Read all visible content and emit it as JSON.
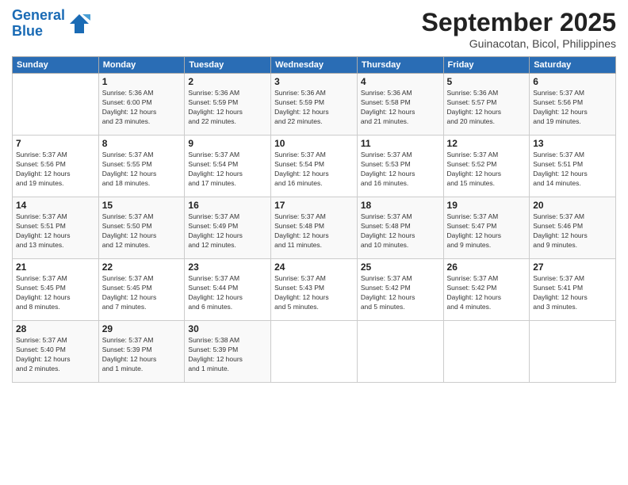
{
  "logo": {
    "line1": "General",
    "line2": "Blue"
  },
  "header": {
    "month": "September 2025",
    "location": "Guinacotan, Bicol, Philippines"
  },
  "columns": [
    "Sunday",
    "Monday",
    "Tuesday",
    "Wednesday",
    "Thursday",
    "Friday",
    "Saturday"
  ],
  "weeks": [
    [
      {
        "day": "",
        "info": ""
      },
      {
        "day": "1",
        "info": "Sunrise: 5:36 AM\nSunset: 6:00 PM\nDaylight: 12 hours\nand 23 minutes."
      },
      {
        "day": "2",
        "info": "Sunrise: 5:36 AM\nSunset: 5:59 PM\nDaylight: 12 hours\nand 22 minutes."
      },
      {
        "day": "3",
        "info": "Sunrise: 5:36 AM\nSunset: 5:59 PM\nDaylight: 12 hours\nand 22 minutes."
      },
      {
        "day": "4",
        "info": "Sunrise: 5:36 AM\nSunset: 5:58 PM\nDaylight: 12 hours\nand 21 minutes."
      },
      {
        "day": "5",
        "info": "Sunrise: 5:36 AM\nSunset: 5:57 PM\nDaylight: 12 hours\nand 20 minutes."
      },
      {
        "day": "6",
        "info": "Sunrise: 5:37 AM\nSunset: 5:56 PM\nDaylight: 12 hours\nand 19 minutes."
      }
    ],
    [
      {
        "day": "7",
        "info": "Sunrise: 5:37 AM\nSunset: 5:56 PM\nDaylight: 12 hours\nand 19 minutes."
      },
      {
        "day": "8",
        "info": "Sunrise: 5:37 AM\nSunset: 5:55 PM\nDaylight: 12 hours\nand 18 minutes."
      },
      {
        "day": "9",
        "info": "Sunrise: 5:37 AM\nSunset: 5:54 PM\nDaylight: 12 hours\nand 17 minutes."
      },
      {
        "day": "10",
        "info": "Sunrise: 5:37 AM\nSunset: 5:54 PM\nDaylight: 12 hours\nand 16 minutes."
      },
      {
        "day": "11",
        "info": "Sunrise: 5:37 AM\nSunset: 5:53 PM\nDaylight: 12 hours\nand 16 minutes."
      },
      {
        "day": "12",
        "info": "Sunrise: 5:37 AM\nSunset: 5:52 PM\nDaylight: 12 hours\nand 15 minutes."
      },
      {
        "day": "13",
        "info": "Sunrise: 5:37 AM\nSunset: 5:51 PM\nDaylight: 12 hours\nand 14 minutes."
      }
    ],
    [
      {
        "day": "14",
        "info": "Sunrise: 5:37 AM\nSunset: 5:51 PM\nDaylight: 12 hours\nand 13 minutes."
      },
      {
        "day": "15",
        "info": "Sunrise: 5:37 AM\nSunset: 5:50 PM\nDaylight: 12 hours\nand 12 minutes."
      },
      {
        "day": "16",
        "info": "Sunrise: 5:37 AM\nSunset: 5:49 PM\nDaylight: 12 hours\nand 12 minutes."
      },
      {
        "day": "17",
        "info": "Sunrise: 5:37 AM\nSunset: 5:48 PM\nDaylight: 12 hours\nand 11 minutes."
      },
      {
        "day": "18",
        "info": "Sunrise: 5:37 AM\nSunset: 5:48 PM\nDaylight: 12 hours\nand 10 minutes."
      },
      {
        "day": "19",
        "info": "Sunrise: 5:37 AM\nSunset: 5:47 PM\nDaylight: 12 hours\nand 9 minutes."
      },
      {
        "day": "20",
        "info": "Sunrise: 5:37 AM\nSunset: 5:46 PM\nDaylight: 12 hours\nand 9 minutes."
      }
    ],
    [
      {
        "day": "21",
        "info": "Sunrise: 5:37 AM\nSunset: 5:45 PM\nDaylight: 12 hours\nand 8 minutes."
      },
      {
        "day": "22",
        "info": "Sunrise: 5:37 AM\nSunset: 5:45 PM\nDaylight: 12 hours\nand 7 minutes."
      },
      {
        "day": "23",
        "info": "Sunrise: 5:37 AM\nSunset: 5:44 PM\nDaylight: 12 hours\nand 6 minutes."
      },
      {
        "day": "24",
        "info": "Sunrise: 5:37 AM\nSunset: 5:43 PM\nDaylight: 12 hours\nand 5 minutes."
      },
      {
        "day": "25",
        "info": "Sunrise: 5:37 AM\nSunset: 5:42 PM\nDaylight: 12 hours\nand 5 minutes."
      },
      {
        "day": "26",
        "info": "Sunrise: 5:37 AM\nSunset: 5:42 PM\nDaylight: 12 hours\nand 4 minutes."
      },
      {
        "day": "27",
        "info": "Sunrise: 5:37 AM\nSunset: 5:41 PM\nDaylight: 12 hours\nand 3 minutes."
      }
    ],
    [
      {
        "day": "28",
        "info": "Sunrise: 5:37 AM\nSunset: 5:40 PM\nDaylight: 12 hours\nand 2 minutes."
      },
      {
        "day": "29",
        "info": "Sunrise: 5:37 AM\nSunset: 5:39 PM\nDaylight: 12 hours\nand 1 minute."
      },
      {
        "day": "30",
        "info": "Sunrise: 5:38 AM\nSunset: 5:39 PM\nDaylight: 12 hours\nand 1 minute."
      },
      {
        "day": "",
        "info": ""
      },
      {
        "day": "",
        "info": ""
      },
      {
        "day": "",
        "info": ""
      },
      {
        "day": "",
        "info": ""
      }
    ]
  ]
}
